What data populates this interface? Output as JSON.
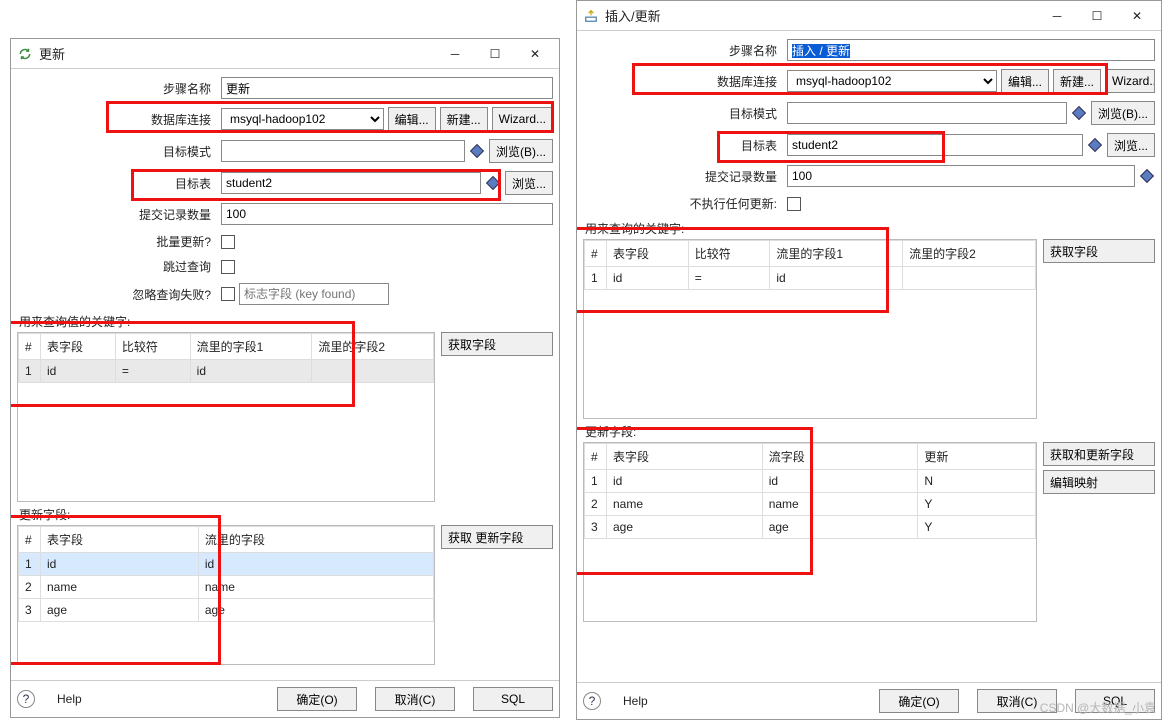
{
  "watermark": "CSDN @大数据_小袁",
  "left": {
    "title": "更新",
    "labels": {
      "step_name": "步骤名称",
      "db_conn": "数据库连接",
      "target_schema": "目标模式",
      "target_table": "目标表",
      "commit_size": "提交记录数量",
      "batch_update": "批量更新?",
      "skip_lookup": "跳过查询",
      "ignore_fail": "忽略查询失败?",
      "flag_field_ph": "标志字段 (key found)"
    },
    "values": {
      "step_name": "更新",
      "db_conn": "msyql-hadoop102",
      "target_schema": "",
      "target_table": "student2",
      "commit_size": "100"
    },
    "buttons": {
      "edit": "编辑...",
      "new": "新建...",
      "wizard": "Wizard...",
      "browse_b": "浏览(B)...",
      "browse": "浏览...",
      "get_fields_key": "获取字段",
      "get_update_fields": "获取 更新字段",
      "ok": "确定(O)",
      "cancel": "取消(C)",
      "sql": "SQL",
      "help": "Help"
    },
    "key_section_title": "用来查询值的关键字:",
    "key_headers": {
      "idx": "#",
      "table_field": "表字段",
      "cmp": "比较符",
      "stream1": "流里的字段1",
      "stream2": "流里的字段2"
    },
    "key_rows": [
      {
        "idx": "1",
        "table_field": "id",
        "cmp": "=",
        "stream1": "id",
        "stream2": ""
      }
    ],
    "upd_section_title": "更新字段:",
    "upd_headers": {
      "idx": "#",
      "table_field": "表字段",
      "stream": "流里的字段"
    },
    "upd_rows": [
      {
        "idx": "1",
        "f": "id",
        "s": "id"
      },
      {
        "idx": "2",
        "f": "name",
        "s": "name"
      },
      {
        "idx": "3",
        "f": "age",
        "s": "age"
      }
    ]
  },
  "right": {
    "title": "插入/更新",
    "labels": {
      "step_name": "步骤名称",
      "db_conn": "数据库连接",
      "target_schema": "目标模式",
      "target_table": "目标表",
      "commit_size": "提交记录数量",
      "no_update": "不执行任何更新:"
    },
    "values": {
      "step_name": "插入 / 更新",
      "db_conn": "msyql-hadoop102",
      "target_schema": "",
      "target_table": "student2",
      "commit_size": "100"
    },
    "buttons": {
      "edit": "编辑...",
      "new": "新建...",
      "wizard": "Wizard...",
      "browse_b": "浏览(B)...",
      "browse": "浏览...",
      "get_fields_key": "获取字段",
      "get_update_fields": "获取和更新字段",
      "edit_mapping": "编辑映射",
      "ok": "确定(O)",
      "cancel": "取消(C)",
      "sql": "SQL",
      "help": "Help"
    },
    "key_section_title": "用来查询的关键字:",
    "key_headers": {
      "idx": "#",
      "table_field": "表字段",
      "cmp": "比较符",
      "stream1": "流里的字段1",
      "stream2": "流里的字段2"
    },
    "key_rows": [
      {
        "idx": "1",
        "table_field": "id",
        "cmp": "=",
        "stream1": "id",
        "stream2": ""
      }
    ],
    "upd_section_title": "更新字段:",
    "upd_headers": {
      "idx": "#",
      "table_field": "表字段",
      "stream": "流字段",
      "update": "更新"
    },
    "upd_rows": [
      {
        "idx": "1",
        "f": "id",
        "s": "id",
        "u": "N"
      },
      {
        "idx": "2",
        "f": "name",
        "s": "name",
        "u": "Y"
      },
      {
        "idx": "3",
        "f": "age",
        "s": "age",
        "u": "Y"
      }
    ]
  }
}
